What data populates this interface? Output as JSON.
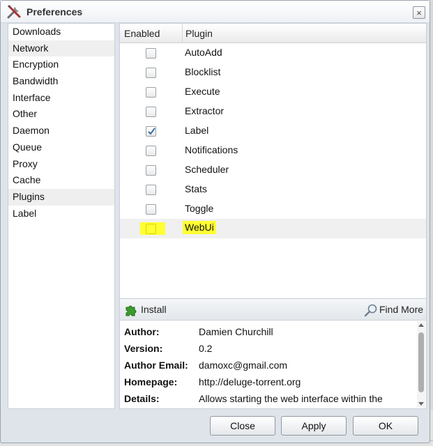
{
  "window": {
    "title": "Preferences",
    "close_glyph": "×"
  },
  "categories": [
    "Downloads",
    "Network",
    "Encryption",
    "Bandwidth",
    "Interface",
    "Other",
    "Daemon",
    "Queue",
    "Proxy",
    "Cache",
    "Plugins",
    "Label"
  ],
  "plugins_table": {
    "headers": {
      "enabled": "Enabled",
      "plugin": "Plugin"
    },
    "rows": [
      {
        "name": "AutoAdd",
        "enabled": false
      },
      {
        "name": "Blocklist",
        "enabled": false
      },
      {
        "name": "Execute",
        "enabled": false
      },
      {
        "name": "Extractor",
        "enabled": false
      },
      {
        "name": "Label",
        "enabled": true
      },
      {
        "name": "Notifications",
        "enabled": false
      },
      {
        "name": "Scheduler",
        "enabled": false
      },
      {
        "name": "Stats",
        "enabled": false
      },
      {
        "name": "Toggle",
        "enabled": false
      },
      {
        "name": "WebUi",
        "enabled": false,
        "selected": true,
        "highlighted": true
      }
    ]
  },
  "toolbar": {
    "install": "Install",
    "find_more": "Find More"
  },
  "info": {
    "author_label": "Author:",
    "author": "Damien Churchill",
    "version_label": "Version:",
    "version": "0.2",
    "email_label": "Author Email:",
    "email": "damoxc@gmail.com",
    "homepage_label": "Homepage:",
    "homepage": "http://deluge-torrent.org",
    "details_label": "Details:",
    "details": "Allows starting the web interface within the"
  },
  "buttons": {
    "close": "Close",
    "apply": "Apply",
    "ok": "OK"
  },
  "colors": {
    "highlight": "#ffff33",
    "accent": "#3a6ea5"
  },
  "icons": {
    "title": "tools-icon",
    "install": "puzzle-icon",
    "find_more": "magnifier-icon"
  }
}
